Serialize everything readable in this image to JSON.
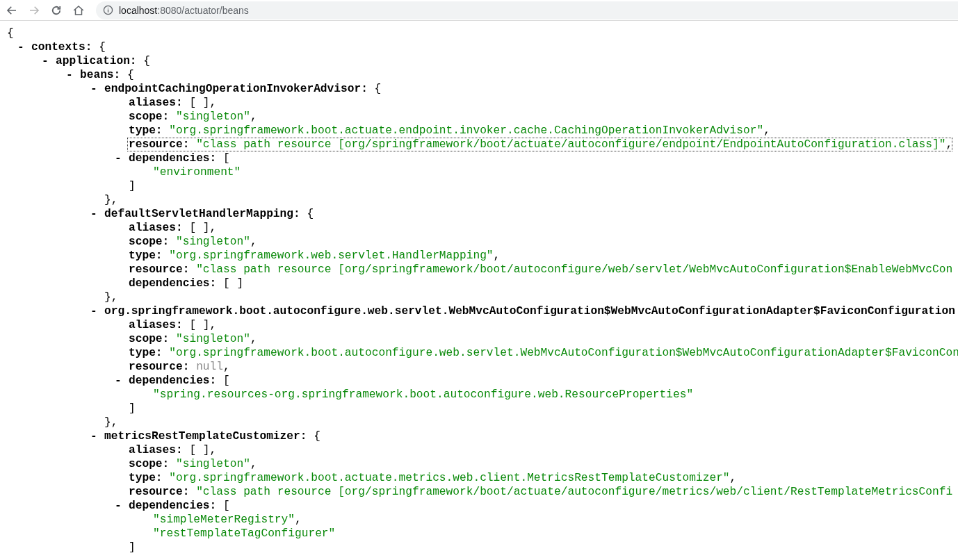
{
  "address_bar": {
    "host": "localhost",
    "path": ":8080/actuator/beans"
  },
  "document": {
    "open": "{",
    "children": [
      {
        "toggle": "-",
        "key": "contexts:",
        "expanded": true,
        "focused": false,
        "open": "{",
        "children": [
          {
            "toggle": "-",
            "key": "application:",
            "expanded": true,
            "focused": false,
            "open": "{",
            "children": [
              {
                "toggle": "-",
                "key": "beans:",
                "expanded": true,
                "focused": false,
                "open": "{",
                "children": [
                  {
                    "toggle": "-",
                    "key": "endpointCachingOperationInvokerAdvisor:",
                    "expanded": true,
                    "focused": false,
                    "open": "{",
                    "children": [
                      {
                        "key": "aliases:",
                        "focused": false,
                        "value": "[ ]",
                        "kind": "empty",
                        "suffix": ","
                      },
                      {
                        "key": "scope:",
                        "focused": false,
                        "value": "\"singleton\"",
                        "kind": "string",
                        "suffix": ","
                      },
                      {
                        "key": "type:",
                        "focused": false,
                        "value": "\"org.springframework.boot.actuate.endpoint.invoker.cache.CachingOperationInvokerAdvisor\"",
                        "kind": "string",
                        "suffix": ","
                      },
                      {
                        "key": "resource:",
                        "focused": true,
                        "value": "\"class path resource [org/springframework/boot/actuate/autoconfigure/endpoint/EndpointAutoConfiguration.class]\"",
                        "kind": "string",
                        "suffix": ","
                      },
                      {
                        "toggle": "-",
                        "key": "dependencies:",
                        "expanded": true,
                        "focused": false,
                        "open": "[",
                        "children": [
                          {
                            "focused": false,
                            "value": "\"environment\"",
                            "kind": "string"
                          }
                        ],
                        "close": "]"
                      }
                    ],
                    "close": "},"
                  },
                  {
                    "toggle": "-",
                    "key": "defaultServletHandlerMapping:",
                    "expanded": true,
                    "focused": false,
                    "open": "{",
                    "children": [
                      {
                        "key": "aliases:",
                        "focused": false,
                        "value": "[ ]",
                        "kind": "empty",
                        "suffix": ","
                      },
                      {
                        "key": "scope:",
                        "focused": false,
                        "value": "\"singleton\"",
                        "kind": "string",
                        "suffix": ","
                      },
                      {
                        "key": "type:",
                        "focused": false,
                        "value": "\"org.springframework.web.servlet.HandlerMapping\"",
                        "kind": "string",
                        "suffix": ","
                      },
                      {
                        "key": "resource:",
                        "focused": false,
                        "value": "\"class path resource [org/springframework/boot/autoconfigure/web/servlet/WebMvcAutoConfiguration$EnableWebMvcCon",
                        "kind": "string"
                      },
                      {
                        "key": "dependencies:",
                        "focused": false,
                        "value": "[ ]",
                        "kind": "empty"
                      }
                    ],
                    "close": "},"
                  },
                  {
                    "toggle": "-",
                    "key": "org.springframework.boot.autoconfigure.web.servlet.WebMvcAutoConfiguration$WebMvcAutoConfigurationAdapter$FaviconConfiguration",
                    "expanded": true,
                    "focused": false,
                    "children": [
                      {
                        "key": "aliases:",
                        "focused": false,
                        "value": "[ ]",
                        "kind": "empty",
                        "suffix": ","
                      },
                      {
                        "key": "scope:",
                        "focused": false,
                        "value": "\"singleton\"",
                        "kind": "string",
                        "suffix": ","
                      },
                      {
                        "key": "type:",
                        "focused": false,
                        "value": "\"org.springframework.boot.autoconfigure.web.servlet.WebMvcAutoConfiguration$WebMvcAutoConfigurationAdapter$FaviconCon",
                        "kind": "string"
                      },
                      {
                        "key": "resource:",
                        "focused": false,
                        "value": "null",
                        "kind": "null",
                        "suffix": ","
                      },
                      {
                        "toggle": "-",
                        "key": "dependencies:",
                        "expanded": true,
                        "focused": false,
                        "open": "[",
                        "children": [
                          {
                            "focused": false,
                            "value": "\"spring.resources-org.springframework.boot.autoconfigure.web.ResourceProperties\"",
                            "kind": "string"
                          }
                        ],
                        "close": "]"
                      }
                    ],
                    "close": "},"
                  },
                  {
                    "toggle": "-",
                    "key": "metricsRestTemplateCustomizer:",
                    "expanded": true,
                    "focused": false,
                    "open": "{",
                    "children": [
                      {
                        "key": "aliases:",
                        "focused": false,
                        "value": "[ ]",
                        "kind": "empty",
                        "suffix": ","
                      },
                      {
                        "key": "scope:",
                        "focused": false,
                        "value": "\"singleton\"",
                        "kind": "string",
                        "suffix": ","
                      },
                      {
                        "key": "type:",
                        "focused": false,
                        "value": "\"org.springframework.boot.actuate.metrics.web.client.MetricsRestTemplateCustomizer\"",
                        "kind": "string",
                        "suffix": ","
                      },
                      {
                        "key": "resource:",
                        "focused": false,
                        "value": "\"class path resource [org/springframework/boot/actuate/autoconfigure/metrics/web/client/RestTemplateMetricsConfi",
                        "kind": "string"
                      },
                      {
                        "toggle": "-",
                        "key": "dependencies:",
                        "expanded": true,
                        "focused": false,
                        "open": "[",
                        "children": [
                          {
                            "focused": false,
                            "value": "\"simpleMeterRegistry\"",
                            "kind": "string",
                            "suffix": ","
                          },
                          {
                            "focused": false,
                            "value": "\"restTemplateTagConfigurer\"",
                            "kind": "string"
                          }
                        ],
                        "close": "]"
                      }
                    ]
                  }
                ]
              }
            ]
          }
        ]
      }
    ]
  }
}
